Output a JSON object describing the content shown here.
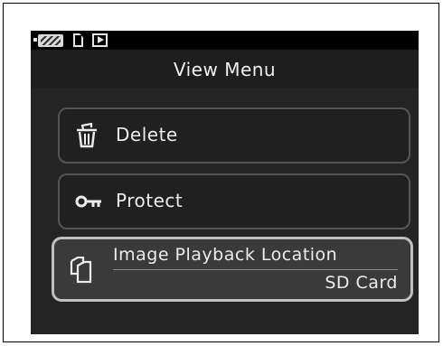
{
  "status": {
    "icons": [
      "battery-icon",
      "sd-card-icon",
      "playback-icon"
    ]
  },
  "title": "View Menu",
  "menu": {
    "items": [
      {
        "label": "Delete",
        "icon": "trash-icon"
      },
      {
        "label": "Protect",
        "icon": "key-icon"
      },
      {
        "label": "Image Playback Location",
        "value": "SD Card",
        "icon": "cards-icon",
        "selected": true
      }
    ]
  },
  "colors": {
    "background": "#1a1a1a",
    "text": "#ececec",
    "selected_border": "#bfbfbf"
  }
}
